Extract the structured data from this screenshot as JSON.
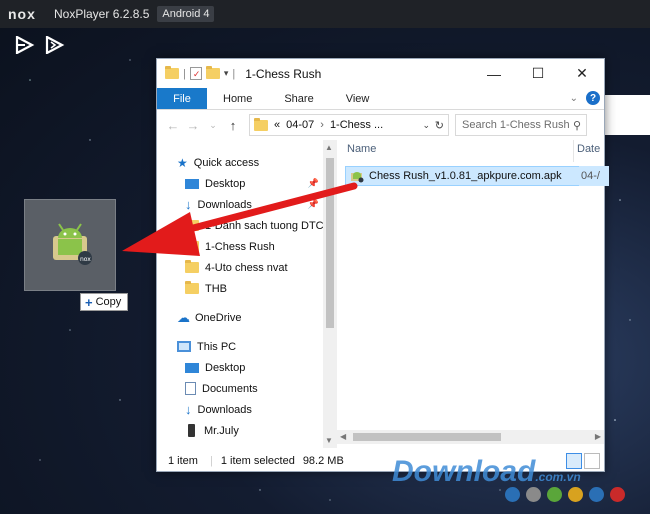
{
  "nox": {
    "logo": "nox",
    "title": "NoxPlayer 6.2.8.5",
    "android_badge": "Android 4"
  },
  "desktop": {
    "copy_tip": "Copy"
  },
  "explorer": {
    "title": "1-Chess Rush",
    "window_buttons": [
      "—",
      "☐",
      "✕"
    ],
    "ribbon": {
      "file": "File",
      "tabs": [
        "Home",
        "Share",
        "View"
      ]
    },
    "address": {
      "prefix": "«",
      "segments": [
        "04-07",
        "1-Chess ..."
      ]
    },
    "search": {
      "placeholder": "Search 1-Chess Rush"
    },
    "nav": [
      {
        "label": "Quick access",
        "icon": "star-icon",
        "pinned": false
      },
      {
        "label": "Desktop",
        "icon": "desktop-icon",
        "pinned": true
      },
      {
        "label": "Downloads",
        "icon": "download-icon",
        "pinned": true
      },
      {
        "label": "1-Danh sach tuong DTC",
        "icon": "folder-icon",
        "pinned": false
      },
      {
        "label": "1-Chess Rush",
        "icon": "folder-icon",
        "pinned": false
      },
      {
        "label": "4-Uto chess nvat",
        "icon": "folder-icon",
        "pinned": false
      },
      {
        "label": "THB",
        "icon": "folder-icon",
        "pinned": false
      },
      {
        "label": "OneDrive",
        "icon": "cloud-icon",
        "pinned": false
      },
      {
        "label": "This PC",
        "icon": "pc-icon",
        "pinned": false
      },
      {
        "label": "Desktop",
        "icon": "desktop-icon",
        "pinned": false
      },
      {
        "label": "Documents",
        "icon": "documents-icon",
        "pinned": false
      },
      {
        "label": "Downloads",
        "icon": "download-icon",
        "pinned": false
      },
      {
        "label": "Mr.July",
        "icon": "phone-icon",
        "pinned": false
      }
    ],
    "columns": {
      "name": "Name",
      "date": "Date"
    },
    "files": [
      {
        "name": "Chess Rush_v1.0.81_apkpure.com.apk",
        "date": "04-/"
      }
    ],
    "status": {
      "count": "1 item",
      "selected": "1 item selected",
      "size": "98.2 MB"
    }
  },
  "watermark": {
    "text": "Download",
    "suffix": ".com.vn"
  },
  "colors": {
    "accent": "#1979ca",
    "selection": "#cce8ff",
    "arrow": "#e21b1b"
  }
}
